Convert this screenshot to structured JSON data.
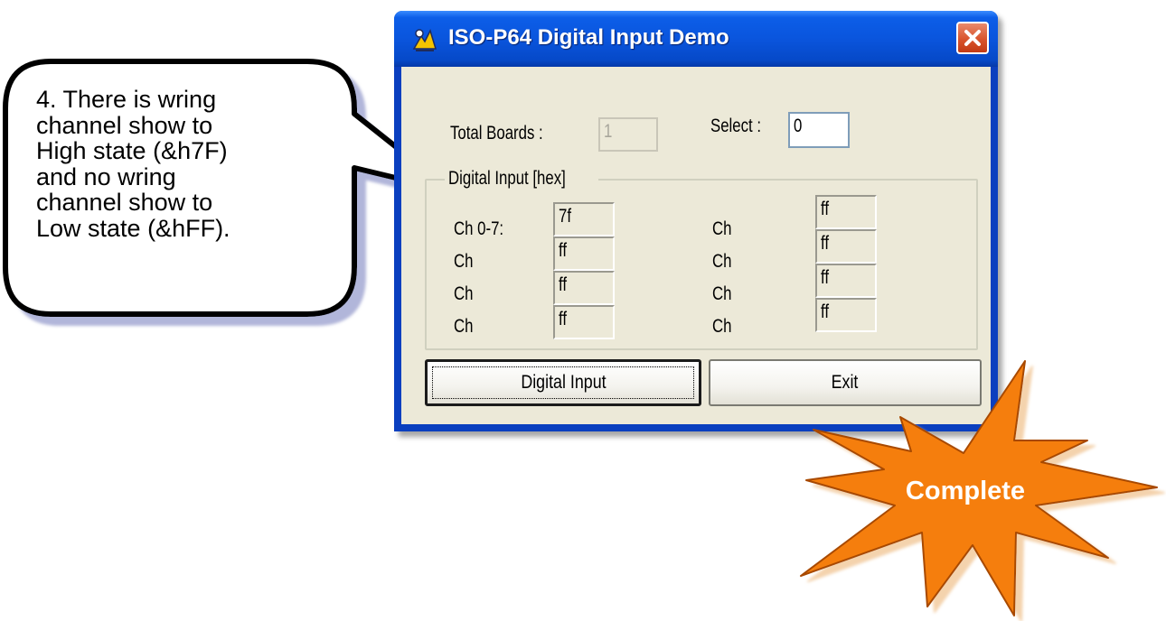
{
  "callout": {
    "text": "4. There is wring\nchannel show to\nHigh state (&h7F)\nand no wring\nchannel show to\nLow state (&hFF)."
  },
  "window": {
    "title": "ISO-P64 Digital Input Demo",
    "icon": "app-icon",
    "close_icon": "close-icon",
    "titlebar_color": "#0a55dd",
    "client_color": "#ece9d8"
  },
  "boards": {
    "total_label": "Total Boards :",
    "total_value": "1",
    "select_label": "Select :",
    "select_value": "0"
  },
  "group": {
    "legend": "Digital Input [hex]",
    "left_channels": [
      {
        "label": "Ch 0-7:",
        "value": "7f"
      },
      {
        "label": "Ch",
        "value": "ff"
      },
      {
        "label": "Ch",
        "value": "ff"
      },
      {
        "label": "Ch",
        "value": "ff"
      }
    ],
    "right_channels": [
      {
        "label": "Ch",
        "value": "ff"
      },
      {
        "label": "Ch",
        "value": "ff"
      },
      {
        "label": "Ch",
        "value": "ff"
      },
      {
        "label": "Ch",
        "value": "ff"
      }
    ]
  },
  "buttons": {
    "digital_input": "Digital Input",
    "exit": "Exit"
  },
  "badge": {
    "text": "Complete",
    "color": "#f57e0a"
  }
}
